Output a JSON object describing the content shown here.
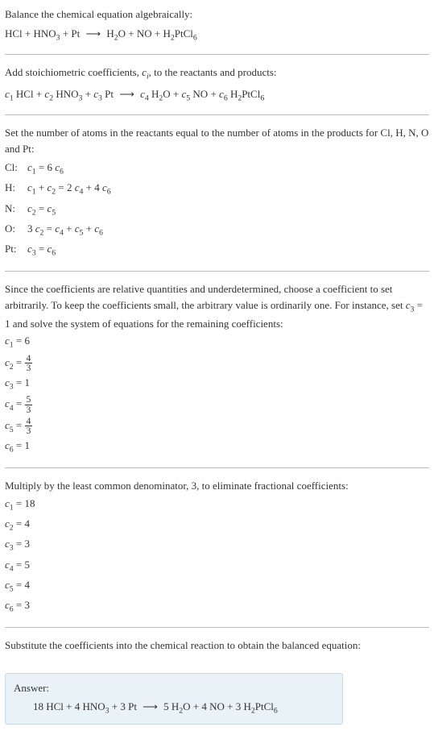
{
  "sections": {
    "intro": {
      "text": "Balance the chemical equation algebraically:",
      "equation": "HCl + HNO₃ + Pt ⟶ H₂O + NO + H₂PtCl₆"
    },
    "stoich": {
      "text_prefix": "Add stoichiometric coefficients, ",
      "text_var": "cᵢ",
      "text_suffix": ", to the reactants and products:",
      "equation": "c₁ HCl + c₂ HNO₃ + c₃ Pt ⟶ c₄ H₂O + c₅ NO + c₆ H₂PtCl₆"
    },
    "atoms": {
      "text": "Set the number of atoms in the reactants equal to the number of atoms in the products for Cl, H, N, O and Pt:",
      "rows": [
        {
          "label": "Cl:",
          "eq": "c₁ = 6 c₆"
        },
        {
          "label": "H:",
          "eq": "c₁ + c₂ = 2 c₄ + 4 c₆"
        },
        {
          "label": "N:",
          "eq": "c₂ = c₅"
        },
        {
          "label": "O:",
          "eq": "3 c₂ = c₄ + c₅ + c₆"
        },
        {
          "label": "Pt:",
          "eq": "c₃ = c₆"
        }
      ]
    },
    "solve": {
      "text": "Since the coefficients are relative quantities and underdetermined, choose a coefficient to set arbitrarily. To keep the coefficients small, the arbitrary value is ordinarily one. For instance, set c₃ = 1 and solve the system of equations for the remaining coefficients:",
      "coefs": [
        {
          "var": "c₁",
          "value": "6",
          "is_fraction": false
        },
        {
          "var": "c₂",
          "num": "4",
          "den": "3",
          "is_fraction": true
        },
        {
          "var": "c₃",
          "value": "1",
          "is_fraction": false
        },
        {
          "var": "c₄",
          "num": "5",
          "den": "3",
          "is_fraction": true
        },
        {
          "var": "c₅",
          "num": "4",
          "den": "3",
          "is_fraction": true
        },
        {
          "var": "c₆",
          "value": "1",
          "is_fraction": false
        }
      ]
    },
    "multiply": {
      "text": "Multiply by the least common denominator, 3, to eliminate fractional coefficients:",
      "coefs": [
        {
          "var": "c₁",
          "value": "18"
        },
        {
          "var": "c₂",
          "value": "4"
        },
        {
          "var": "c₃",
          "value": "3"
        },
        {
          "var": "c₄",
          "value": "5"
        },
        {
          "var": "c₅",
          "value": "4"
        },
        {
          "var": "c₆",
          "value": "3"
        }
      ]
    },
    "final": {
      "text": "Substitute the coefficients into the chemical reaction to obtain the balanced equation:"
    },
    "answer": {
      "label": "Answer:",
      "equation": "18 HCl + 4 HNO₃ + 3 Pt ⟶ 5 H₂O + 4 NO + 3 H₂PtCl₆"
    }
  }
}
